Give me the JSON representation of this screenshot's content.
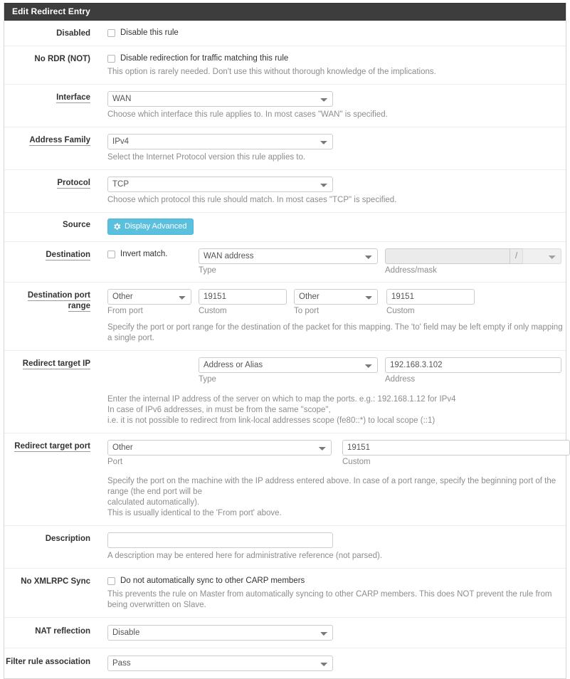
{
  "panel": {
    "title": "Edit Redirect Entry"
  },
  "colors": {
    "header_bg": "#3d3d3d",
    "advanced_button": "#5bc0de",
    "help_text": "#8d8d8d"
  },
  "rows": {
    "disabled": {
      "label": "Disabled",
      "checkbox_label": "Disable this rule"
    },
    "no_rdr": {
      "label": "No RDR (NOT)",
      "checkbox_label": "Disable redirection for traffic matching this rule",
      "help": "This option is rarely needed. Don't use this without thorough knowledge of the implications."
    },
    "interface": {
      "label": "Interface",
      "value": "WAN",
      "help": "Choose which interface this rule applies to. In most cases \"WAN\" is specified."
    },
    "address_family": {
      "label": "Address Family",
      "value": "IPv4",
      "help": "Select the Internet Protocol version this rule applies to."
    },
    "protocol": {
      "label": "Protocol",
      "value": "TCP",
      "help": "Choose which protocol this rule should match. In most cases \"TCP\" is specified."
    },
    "source": {
      "label": "Source",
      "advanced_button_label": "Display Advanced",
      "advanced_button_icon": "gear-icon"
    },
    "destination": {
      "label": "Destination",
      "invert_label": "Invert match.",
      "type_value": "WAN address",
      "type_sublabel": "Type",
      "address_value": "",
      "address_separator": "/",
      "mask_value": "",
      "address_sublabel": "Address/mask"
    },
    "destination_port_range": {
      "label": "Destination port range",
      "from_port_value": "Other",
      "from_port_sublabel": "From port",
      "from_custom_value": "19151",
      "from_custom_sublabel": "Custom",
      "to_port_value": "Other",
      "to_port_sublabel": "To port",
      "to_custom_value": "19151",
      "to_custom_sublabel": "Custom",
      "help": "Specify the port or port range for the destination of the packet for this mapping. The 'to' field may be left empty if only mapping a single port."
    },
    "redirect_target_ip": {
      "label": "Redirect target IP",
      "type_value": "Address or Alias",
      "type_sublabel": "Type",
      "address_value": "192.168.3.102",
      "address_sublabel": "Address",
      "help_line1": "Enter the internal IP address of the server on which to map the ports. e.g.: 192.168.1.12 for IPv4",
      "help_line2": "In case of IPv6 addresses, in must be from the same \"scope\",",
      "help_line3": "i.e. it is not possible to redirect from link-local addresses scope (fe80::*) to local scope (::1)"
    },
    "redirect_target_port": {
      "label": "Redirect target port",
      "port_value": "Other",
      "port_sublabel": "Port",
      "custom_value": "19151",
      "custom_sublabel": "Custom",
      "help_line1": "Specify the port on the machine with the IP address entered above. In case of a port range, specify the beginning port of the range (the end port will be",
      "help_line2": "calculated automatically).",
      "help_line3": "This is usually identical to the 'From port' above."
    },
    "description": {
      "label": "Description",
      "value": "",
      "placeholder": "",
      "help": "A description may be entered here for administrative reference (not parsed)."
    },
    "no_xmlrpc_sync": {
      "label": "No XMLRPC Sync",
      "checkbox_label": "Do not automatically sync to other CARP members",
      "help": "This prevents the rule on Master from automatically syncing to other CARP members. This does NOT prevent the rule from being overwritten on Slave."
    },
    "nat_reflection": {
      "label": "NAT reflection",
      "value": "Disable"
    },
    "filter_rule_association": {
      "label": "Filter rule association",
      "value": "Pass"
    }
  }
}
